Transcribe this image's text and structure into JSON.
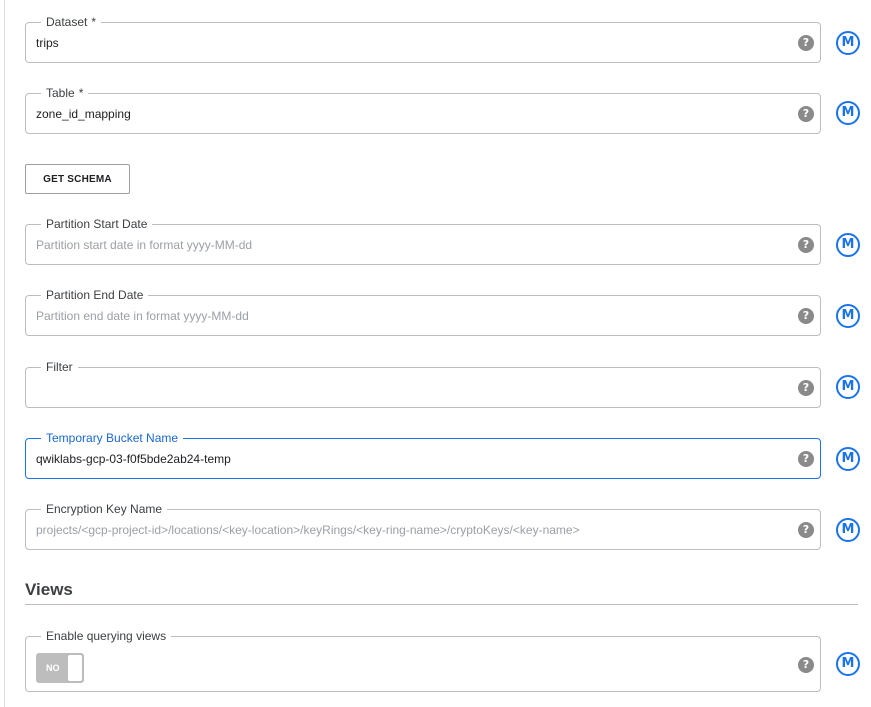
{
  "fields": {
    "dataset": {
      "label": "Dataset",
      "required_marker": "*",
      "value": "trips"
    },
    "table": {
      "label": "Table",
      "required_marker": "*",
      "value": "zone_id_mapping"
    },
    "partition_start": {
      "label": "Partition Start Date",
      "placeholder": "Partition start date in format yyyy-MM-dd"
    },
    "partition_end": {
      "label": "Partition End Date",
      "placeholder": "Partition end date in format yyyy-MM-dd"
    },
    "filter": {
      "label": "Filter",
      "value": ""
    },
    "temp_bucket": {
      "label": "Temporary Bucket Name",
      "value": "qwiklabs-gcp-03-f0f5bde2ab24-temp"
    },
    "encryption_key": {
      "label": "Encryption Key Name",
      "placeholder": "projects/<gcp-project-id>/locations/<key-location>/keyRings/<key-ring-name>/cryptoKeys/<key-name>"
    },
    "querying_views": {
      "label": "Enable querying views",
      "toggle_state": "NO"
    }
  },
  "buttons": {
    "get_schema": "GET SCHEMA"
  },
  "sections": {
    "views_title": "Views"
  },
  "icons": {
    "help": "?",
    "macro": "M"
  },
  "colors": {
    "accent": "#1a73e8",
    "focused_label": "#1967d2",
    "help_icon": "#8a8a8a"
  }
}
